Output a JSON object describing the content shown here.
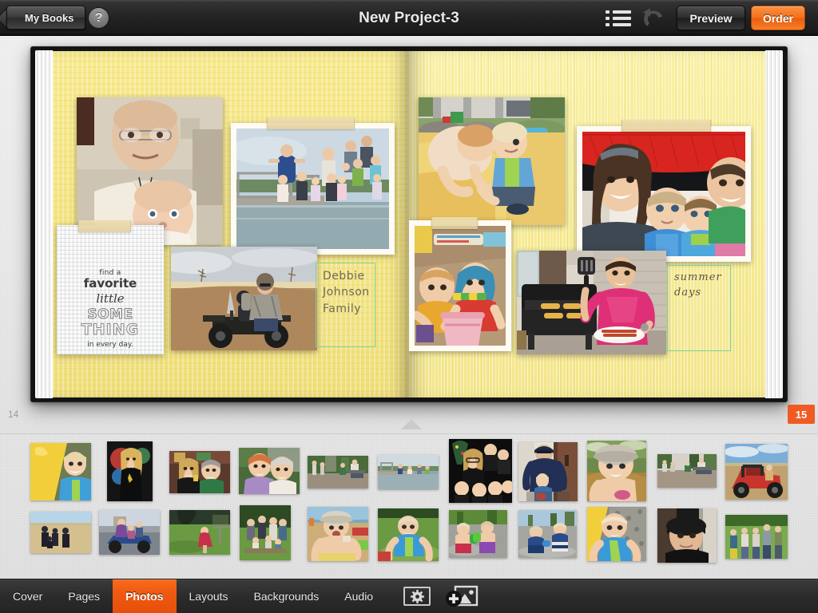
{
  "toolbar": {
    "back_label": "My Books",
    "help_label": "?",
    "project_title": "New Project-3",
    "list_icon": "list-view-icon",
    "undo_icon": "undo-arrow-icon",
    "preview_label": "Preview",
    "order_label": "Order",
    "order_color": "#ef5b22"
  },
  "spread": {
    "left_page_number": "14",
    "right_page_number": "15",
    "left_page": {
      "quote_card": {
        "line1": "find a",
        "line2": "favorite",
        "line3": "little",
        "line4": "SOME",
        "line5": "THING",
        "line6": "in every day."
      },
      "text_box": {
        "line1": "Debbie",
        "line2": "Johnson",
        "line3": "Family"
      },
      "photos": [
        {
          "name": "photo-grandfather-and-baby"
        },
        {
          "name": "photo-family-group-on-dock"
        },
        {
          "name": "photo-man-and-child-on-atv"
        }
      ]
    },
    "right_page": {
      "text_box": {
        "line1": "summer",
        "line2": "days"
      },
      "photos": [
        {
          "name": "photo-two-toddlers-on-slide"
        },
        {
          "name": "photo-family-selfie-under-blanket"
        },
        {
          "name": "photo-kids-with-sand-bucket"
        },
        {
          "name": "photo-man-grilling-hotdogs"
        }
      ]
    }
  },
  "tray": {
    "selection_border_color": "#7fd19a",
    "thumbnails": [
      {
        "name": "thumb-boy-on-yellow-slide"
      },
      {
        "name": "thumb-woman-in-black-dress"
      },
      {
        "name": "thumb-two-women-smiling"
      },
      {
        "name": "thumb-two-older-women"
      },
      {
        "name": "thumb-family-on-patio"
      },
      {
        "name": "thumb-people-on-dock"
      },
      {
        "name": "thumb-christmas-family-portrait"
      },
      {
        "name": "thumb-man-with-toddler-indoors"
      },
      {
        "name": "thumb-toddler-in-hat"
      },
      {
        "name": "thumb-men-in-lawn-chairs"
      },
      {
        "name": "thumb-red-utv-in-field"
      },
      {
        "name": "thumb-group-in-field"
      },
      {
        "name": "thumb-family-on-atv"
      },
      {
        "name": "thumb-woman-in-red-dress"
      },
      {
        "name": "thumb-family-portrait-outdoors"
      },
      {
        "name": "thumb-boy-eating-at-beach"
      },
      {
        "name": "thumb-boy-in-grass"
      },
      {
        "name": "thumb-kids-at-splash-pad"
      },
      {
        "name": "thumb-two-boys-in-water"
      },
      {
        "name": "thumb-baby-on-yellow-slide"
      },
      {
        "name": "thumb-man-in-black-cap"
      },
      {
        "name": "thumb-kids-lined-up-outdoors"
      }
    ]
  },
  "tabbar": {
    "tabs": [
      {
        "label": "Cover",
        "active": false
      },
      {
        "label": "Pages",
        "active": false
      },
      {
        "label": "Photos",
        "active": true
      },
      {
        "label": "Layouts",
        "active": false
      },
      {
        "label": "Backgrounds",
        "active": false
      },
      {
        "label": "Audio",
        "active": false
      }
    ],
    "active_color": "#ef5b22",
    "settings_icon": "gear-icon",
    "add_photo_icon": "add-photo-icon"
  }
}
